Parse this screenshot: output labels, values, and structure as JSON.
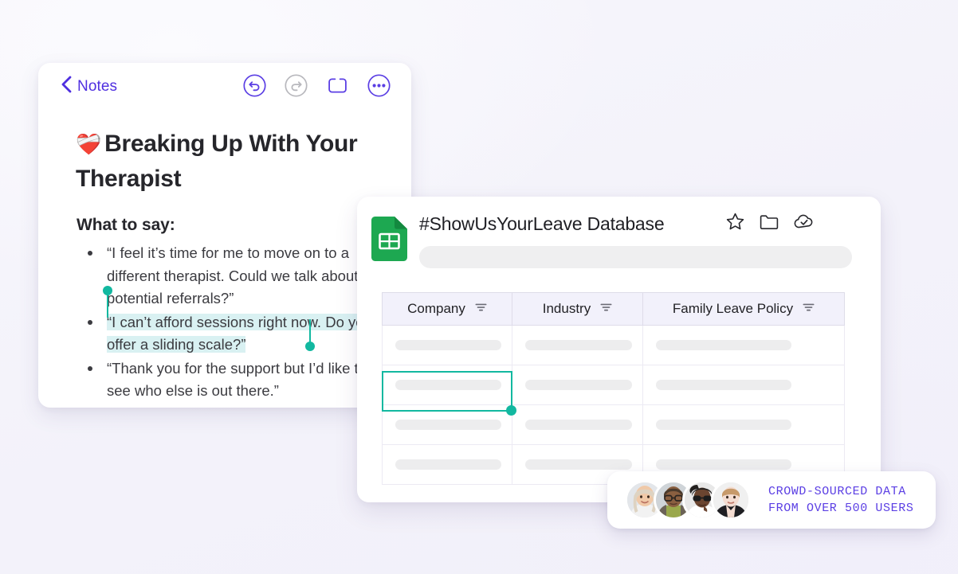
{
  "theme": {
    "page_background": "#f4f3fa",
    "accent_purple": "#4f2fe0",
    "selection_teal": "#12b8a0",
    "selection_highlight": "#d9f1f2",
    "sheets_green": "#1da851",
    "header_lavender": "#f2f1fb",
    "crowd_text_purple": "#5b3fe4"
  },
  "notes": {
    "back_label": "Notes",
    "back_icon": "chevron-left-icon",
    "toolbar_icons": [
      {
        "name": "undo-icon",
        "label": "Undo",
        "state": "enabled"
      },
      {
        "name": "redo-icon",
        "label": "Redo",
        "state": "disabled"
      },
      {
        "name": "markup-icon",
        "label": "Markup"
      },
      {
        "name": "more-options-icon",
        "label": "More"
      }
    ],
    "title_emoji": "❤️‍🩹",
    "title": "Breaking Up With Your Therapist",
    "subheading": "What to say:",
    "bullets": [
      {
        "text": "“I feel it’s time for me to move on to a different therapist. Could we talk about potential referrals?”",
        "selected": false
      },
      {
        "text": "“I can’t afford sessions right now. Do you offer a sliding scale?”",
        "selected": true
      },
      {
        "text": "“Thank you for the support but I’d like to see who else is out there.”",
        "selected": false
      }
    ]
  },
  "sheets": {
    "doc_icon": "google-sheets-icon",
    "title": "#ShowUsYourLeave Database",
    "header_icons": [
      {
        "name": "star-icon",
        "label": "Star"
      },
      {
        "name": "folder-icon",
        "label": "Move"
      },
      {
        "name": "cloud-check-icon",
        "label": "Saved to Drive"
      }
    ],
    "search_placeholder": "",
    "search_value": "",
    "table": {
      "columns": [
        {
          "label": "Company",
          "filter_icon": "filter-icon"
        },
        {
          "label": "Industry",
          "filter_icon": "filter-icon"
        },
        {
          "label": "Family Leave Policy",
          "filter_icon": "filter-icon"
        }
      ],
      "rows": [
        {
          "cells": [
            "",
            "",
            ""
          ],
          "loading": true
        },
        {
          "cells": [
            "",
            "",
            ""
          ],
          "loading": true
        },
        {
          "cells": [
            "",
            "",
            ""
          ],
          "loading": true
        },
        {
          "cells": [
            "",
            "",
            ""
          ],
          "loading": true
        }
      ],
      "selected_cell": {
        "row": 2,
        "column": 1
      }
    }
  },
  "crowd_badge": {
    "line1": "CROWD-SOURCED DATA",
    "line2": "FROM OVER 500 USERS",
    "avatar_count": 4,
    "avatars": [
      {
        "name": "avatar-1"
      },
      {
        "name": "avatar-2"
      },
      {
        "name": "avatar-3"
      },
      {
        "name": "avatar-4"
      }
    ]
  }
}
